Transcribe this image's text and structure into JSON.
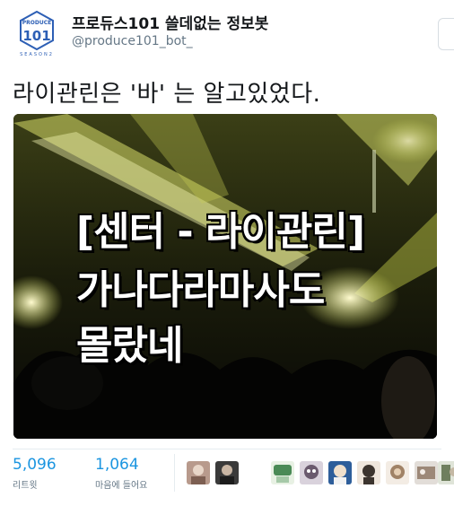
{
  "account": {
    "display_name": "프로듀스101 쓸데없는 정보봇",
    "handle": "@produce101_bot_",
    "avatar_logo_top": "PRODUCE",
    "avatar_logo_num": "101",
    "avatar_logo_bottom": "SEASON2"
  },
  "tweet": {
    "text": "라이관린은 '바' 는 알고있었다.",
    "image_caption": {
      "line1": "[센터 - 라이관린]",
      "line2": "가나다라마사도",
      "line3": "몰랐네"
    }
  },
  "stats": {
    "retweets": {
      "count": "5,096",
      "label": "리트윗"
    },
    "likes": {
      "count": "1,064",
      "label": "마음에 들어요"
    }
  },
  "likers": [
    {
      "name": "liker-1",
      "color": "#b89a8c"
    },
    {
      "name": "liker-2",
      "color": "#3a3a3a"
    },
    {
      "name": "liker-3",
      "color": "#4a8a56"
    },
    {
      "name": "liker-4",
      "color": "#6a5a6e"
    },
    {
      "name": "liker-5",
      "color": "#2e5e9a"
    },
    {
      "name": "liker-6",
      "color": "#3c342e"
    },
    {
      "name": "liker-7",
      "color": "#a08266"
    },
    {
      "name": "liker-8",
      "color": "#9c8878"
    },
    {
      "name": "liker-9",
      "color": "#6f7f5e"
    }
  ],
  "colors": {
    "link_blue": "#1b95e0",
    "secondary_gray": "#657786",
    "brand_blue": "#2d5fb5"
  }
}
